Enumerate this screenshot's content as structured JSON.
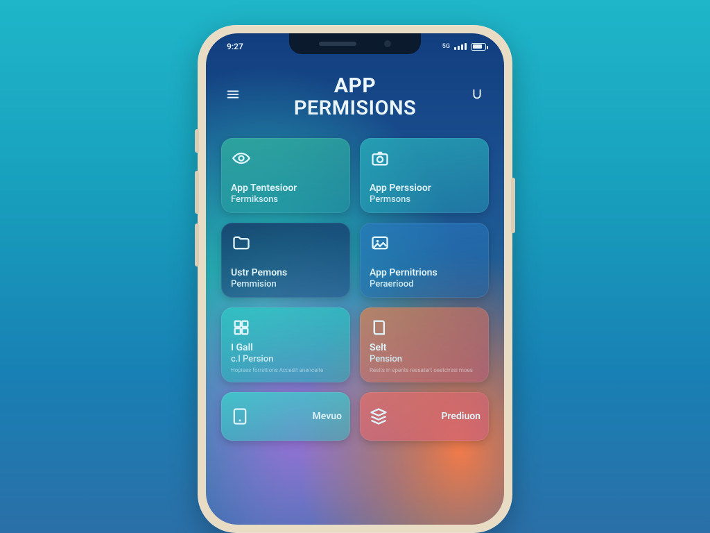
{
  "status": {
    "time": "9:27",
    "carrier": "5G"
  },
  "header": {
    "title_line1": "APP",
    "title_line2": "Permisions"
  },
  "tiles": [
    {
      "line1": "App Tentesioor",
      "line2": "Fermiksons",
      "icon": "eye-icon"
    },
    {
      "line1": "App Perssioor",
      "line2": "Permsons",
      "icon": "camera-icon"
    },
    {
      "line1": "Ustr Pemons",
      "line2": "Pemmision",
      "icon": "folder-icon"
    },
    {
      "line1": "App Pernitrions",
      "line2": "Peraeriood",
      "icon": "photo-icon"
    },
    {
      "line1": "I Gall",
      "line2": "c.l Persion",
      "subtitle": "Hopises  forrsitions  Accedit  anenceite",
      "icon": "grid-icon"
    },
    {
      "line1": "Selt",
      "line2": "Pension",
      "subtitle": "Resits in spents ressatert oeetcirssi moes",
      "icon": "book-icon"
    },
    {
      "line1": "Mevuo",
      "line2": "",
      "icon": "device-icon"
    },
    {
      "line1": "Prediuon",
      "line2": "",
      "icon": "stack-icon"
    }
  ]
}
